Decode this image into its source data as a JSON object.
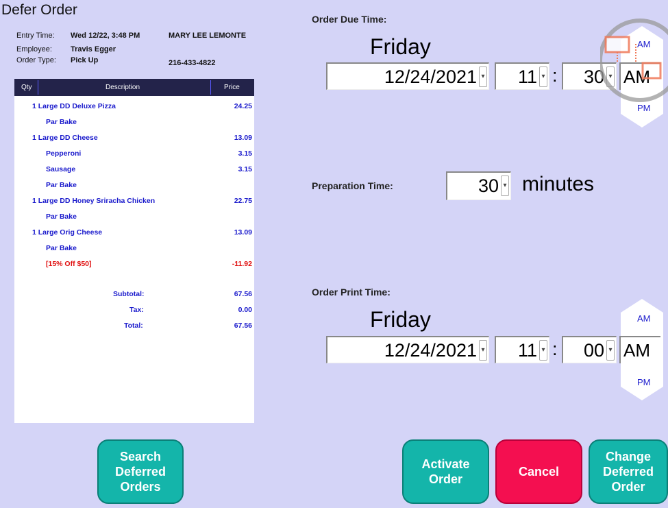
{
  "title": "Defer Order",
  "order_info": {
    "entry_time_label": "Entry Time:",
    "entry_time": "Wed 12/22, 3:48 PM",
    "employee_label": "Employee:",
    "employee": "Travis Egger",
    "order_type_label": "Order Type:",
    "order_type": "Pick Up",
    "customer_name": "MARY LEE LEMONTE",
    "customer_phone": "216-433-4822"
  },
  "receipt": {
    "headers": {
      "qty": "Qty",
      "description": "Description",
      "price": "Price"
    },
    "items": [
      {
        "text": "1 Large DD Deluxe Pizza",
        "price": "24.25",
        "indent": 0
      },
      {
        "text": "Par Bake",
        "price": "",
        "indent": 1
      },
      {
        "text": "1 Large DD Cheese",
        "price": "13.09",
        "indent": 0
      },
      {
        "text": "Pepperoni",
        "price": "3.15",
        "indent": 1
      },
      {
        "text": "Sausage",
        "price": "3.15",
        "indent": 1
      },
      {
        "text": "Par Bake",
        "price": "",
        "indent": 1
      },
      {
        "text": "1 Large DD Honey Sriracha Chicken",
        "price": "22.75",
        "indent": 0
      },
      {
        "text": "Par Bake",
        "price": "",
        "indent": 1
      },
      {
        "text": "1 Large Orig Cheese",
        "price": "13.09",
        "indent": 0
      },
      {
        "text": "Par Bake",
        "price": "",
        "indent": 1
      },
      {
        "text": "[15% Off $50]",
        "price": "-11.92",
        "indent": 1,
        "discount": true
      }
    ],
    "subtotal_label": "Subtotal:",
    "subtotal": "67.56",
    "tax_label": "Tax:",
    "tax": "0.00",
    "total_label": "Total:",
    "total": "67.56"
  },
  "due_time": {
    "label": "Order Due Time:",
    "day": "Friday",
    "date": "12/24/2021",
    "hour": "11",
    "colon": ":",
    "minute": "30",
    "ampm": "AM",
    "am_label": "AM",
    "pm_label": "PM"
  },
  "prep_time": {
    "label": "Preparation Time:",
    "value": "30",
    "unit": "minutes"
  },
  "print_time": {
    "label": "Order Print Time:",
    "day": "Friday",
    "date": "12/24/2021",
    "hour": "11",
    "colon": ":",
    "minute": "00",
    "ampm": "AM",
    "am_label": "AM",
    "pm_label": "PM"
  },
  "buttons": {
    "search": "Search\nDeferred\nOrders",
    "activate": "Activate\nOrder",
    "cancel": "Cancel",
    "change": "Change\nDeferred\nOrder"
  },
  "colors": {
    "background": "#d4d4f7",
    "button_teal": "#14b5aa",
    "button_red": "#f40f50",
    "item_blue": "#1a1acc",
    "discount_red": "#e01010"
  }
}
